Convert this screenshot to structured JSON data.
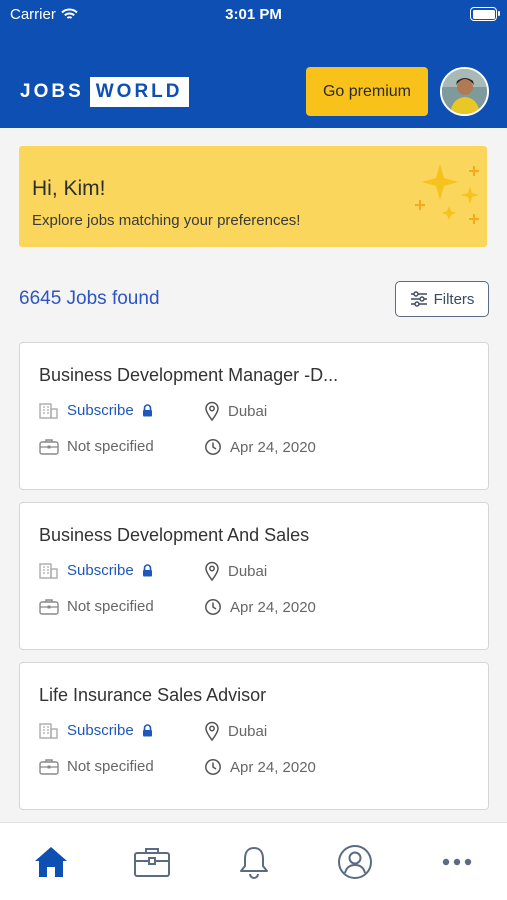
{
  "status_bar": {
    "carrier": "Carrier",
    "time": "3:01 PM"
  },
  "header": {
    "logo_left": "JOBS",
    "logo_right": "WORLD",
    "premium_label": "Go premium",
    "avatar_icon": "user-avatar-photo"
  },
  "greeting": {
    "title": "Hi, Kim!",
    "subtitle": "Explore jobs matching your preferences!",
    "icon": "sparkles-icon"
  },
  "results": {
    "count_text": "6645 Jobs found",
    "filters_label": "Filters"
  },
  "jobs": [
    {
      "title": "Business Development Manager -D...",
      "company": "Subscribe",
      "location": "Dubai",
      "salary": "Not specified",
      "date": "Apr 24, 2020"
    },
    {
      "title": "Business Development And Sales",
      "company": "Subscribe",
      "location": "Dubai",
      "salary": "Not specified",
      "date": "Apr 24, 2020"
    },
    {
      "title": "Life Insurance Sales Advisor",
      "company": "Subscribe",
      "location": "Dubai",
      "salary": "Not specified",
      "date": "Apr 24, 2020"
    }
  ],
  "tabs": [
    {
      "icon": "home-icon",
      "active": true
    },
    {
      "icon": "briefcase-icon",
      "active": false
    },
    {
      "icon": "bell-icon",
      "active": false
    },
    {
      "icon": "profile-icon",
      "active": false
    },
    {
      "icon": "more-icon",
      "active": false
    }
  ],
  "colors": {
    "brand_blue": "#0d4fb3",
    "accent_yellow": "#f9c21b",
    "banner_yellow": "#fad65c",
    "link_blue": "#1f58bd"
  }
}
